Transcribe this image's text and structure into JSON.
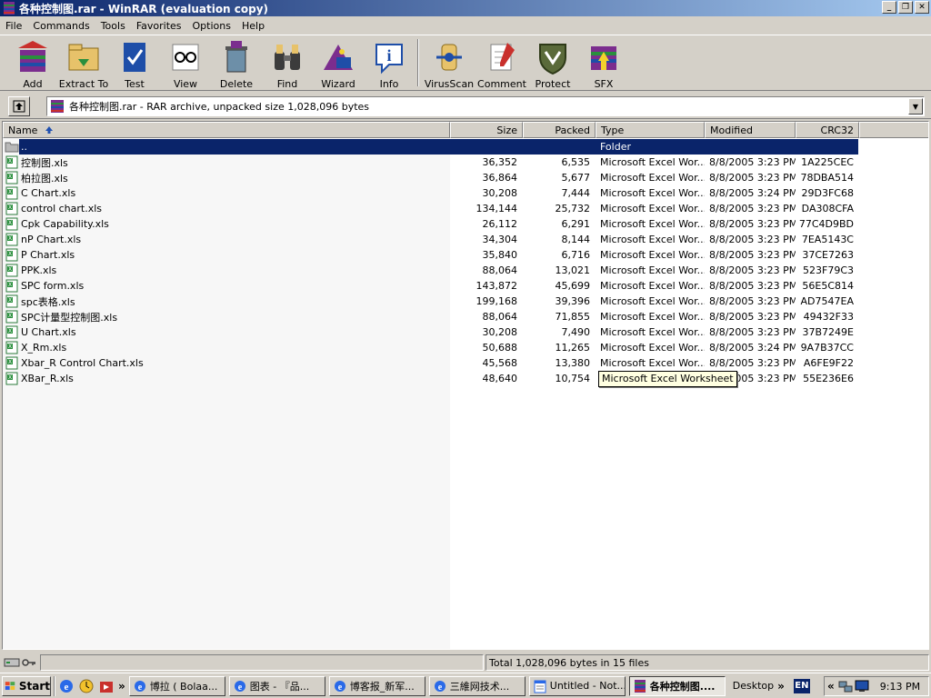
{
  "window": {
    "title": "各种控制图.rar - WinRAR (evaluation copy)"
  },
  "menu": [
    "File",
    "Commands",
    "Tools",
    "Favorites",
    "Options",
    "Help"
  ],
  "toolbar": {
    "buttons": [
      "Add",
      "Extract To",
      "Test",
      "View",
      "Delete",
      "Find",
      "Wizard",
      "Info",
      "VirusScan",
      "Comment",
      "Protect",
      "SFX"
    ]
  },
  "address": {
    "text": "各种控制图.rar - RAR archive, unpacked size 1,028,096 bytes"
  },
  "columns": {
    "name": "Name",
    "size": "Size",
    "packed": "Packed",
    "type": "Type",
    "modified": "Modified",
    "crc": "CRC32"
  },
  "parent_row": {
    "name": "..",
    "type": "Folder"
  },
  "files": [
    {
      "name": "控制图.xls",
      "size": "36,352",
      "packed": "6,535",
      "type": "Microsoft Excel Wor...",
      "modified": "8/8/2005 3:23 PM",
      "crc": "1A225CEC"
    },
    {
      "name": "柏拉图.xls",
      "size": "36,864",
      "packed": "5,677",
      "type": "Microsoft Excel Wor...",
      "modified": "8/8/2005 3:23 PM",
      "crc": "78DBA514"
    },
    {
      "name": "C Chart.xls",
      "size": "30,208",
      "packed": "7,444",
      "type": "Microsoft Excel Wor...",
      "modified": "8/8/2005 3:24 PM",
      "crc": "29D3FC68"
    },
    {
      "name": "control chart.xls",
      "size": "134,144",
      "packed": "25,732",
      "type": "Microsoft Excel Wor...",
      "modified": "8/8/2005 3:23 PM",
      "crc": "DA308CFA"
    },
    {
      "name": "Cpk Capability.xls",
      "size": "26,112",
      "packed": "6,291",
      "type": "Microsoft Excel Wor...",
      "modified": "8/8/2005 3:23 PM",
      "crc": "77C4D9BD"
    },
    {
      "name": "nP Chart.xls",
      "size": "34,304",
      "packed": "8,144",
      "type": "Microsoft Excel Wor...",
      "modified": "8/8/2005 3:23 PM",
      "crc": "7EA5143C"
    },
    {
      "name": "P Chart.xls",
      "size": "35,840",
      "packed": "6,716",
      "type": "Microsoft Excel Wor...",
      "modified": "8/8/2005 3:23 PM",
      "crc": "37CE7263"
    },
    {
      "name": "PPK.xls",
      "size": "88,064",
      "packed": "13,021",
      "type": "Microsoft Excel Wor...",
      "modified": "8/8/2005 3:23 PM",
      "crc": "523F79C3"
    },
    {
      "name": "SPC form.xls",
      "size": "143,872",
      "packed": "45,699",
      "type": "Microsoft Excel Wor...",
      "modified": "8/8/2005 3:23 PM",
      "crc": "56E5C814"
    },
    {
      "name": "spc表格.xls",
      "size": "199,168",
      "packed": "39,396",
      "type": "Microsoft Excel Wor...",
      "modified": "8/8/2005 3:23 PM",
      "crc": "AD7547EA"
    },
    {
      "name": "SPC计量型控制图.xls",
      "size": "88,064",
      "packed": "71,855",
      "type": "Microsoft Excel Wor...",
      "modified": "8/8/2005 3:23 PM",
      "crc": "49432F33"
    },
    {
      "name": "U Chart.xls",
      "size": "30,208",
      "packed": "7,490",
      "type": "Microsoft Excel Wor...",
      "modified": "8/8/2005 3:23 PM",
      "crc": "37B7249E"
    },
    {
      "name": "X_Rm.xls",
      "size": "50,688",
      "packed": "11,265",
      "type": "Microsoft Excel Wor...",
      "modified": "8/8/2005 3:24 PM",
      "crc": "9A7B37CC"
    },
    {
      "name": "Xbar_R Control Chart.xls",
      "size": "45,568",
      "packed": "13,380",
      "type": "Microsoft Excel Wor...",
      "modified": "8/8/2005 3:23 PM",
      "crc": "A6FE9F22"
    },
    {
      "name": "XBar_R.xls",
      "size": "48,640",
      "packed": "10,754",
      "type": "Microsoft Excel Wor...",
      "modified": "8/8/2005 3:23 PM",
      "crc": "55E236E6"
    }
  ],
  "tooltip": {
    "text": "Microsoft Excel Worksheet"
  },
  "status": {
    "text": "Total 1,028,096 bytes in 15 files"
  },
  "taskbar": {
    "start": "Start",
    "tasks": [
      {
        "label": "博拉 ( Bolaa...",
        "icon": "ie-icon",
        "active": false
      },
      {
        "label": "图表 - 『品...",
        "icon": "ie-icon",
        "active": false
      },
      {
        "label": "博客报_新军...",
        "icon": "ie-icon",
        "active": false
      },
      {
        "label": "三維网技术...",
        "icon": "ie-icon",
        "active": false
      },
      {
        "label": "Untitled - Not...",
        "icon": "notepad-icon",
        "active": false
      },
      {
        "label": "各种控制图....",
        "icon": "winrar-icon",
        "active": true
      }
    ],
    "desktop": "Desktop",
    "lang": "EN",
    "clock": "9:13 PM"
  },
  "colors": {
    "title_start": "#0a246a",
    "title_end": "#a6caf0",
    "selection": "#0a246a",
    "face": "#d4d0c8"
  }
}
